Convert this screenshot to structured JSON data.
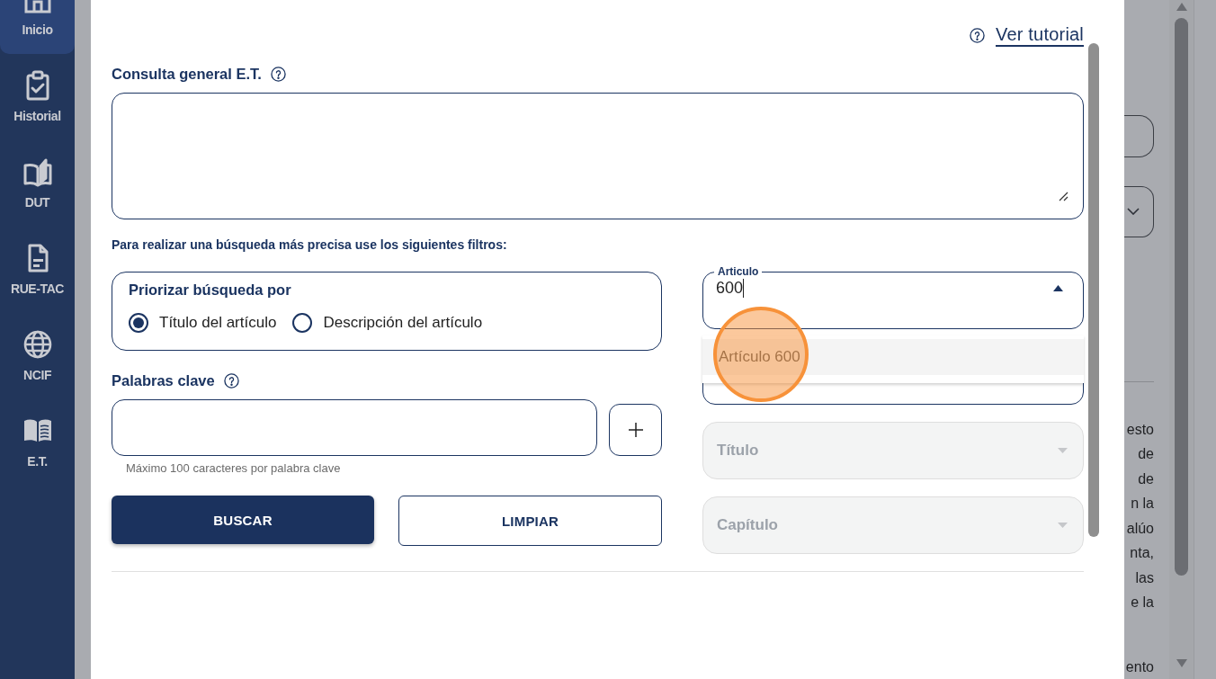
{
  "sidebar": {
    "items": [
      {
        "label": "Inicio",
        "selected": true
      },
      {
        "label": "Historial",
        "selected": false
      },
      {
        "label": "DUT",
        "selected": false
      },
      {
        "label": "RUE-TAC",
        "selected": false
      },
      {
        "label": "NCIF",
        "selected": false
      },
      {
        "label": "E.T.",
        "selected": false
      }
    ]
  },
  "dialog": {
    "tutorial_link": "Ver tutorial",
    "query": {
      "label": "Consulta general E.T."
    },
    "filters_hint": "Para realizar una búsqueda más precisa use los siguientes filtros:",
    "priority": {
      "title": "Priorizar búsqueda por",
      "options": [
        {
          "label": "Título del artículo",
          "selected": true
        },
        {
          "label": "Descripción del artículo",
          "selected": false
        }
      ]
    },
    "keywords": {
      "label": "Palabras clave",
      "hint": "Máximo 100 caracteres por palabra clave"
    },
    "buttons": [
      {
        "label": "BUSCAR",
        "kind": "primary"
      },
      {
        "label": "LIMPIAR",
        "kind": "outline"
      }
    ],
    "article": {
      "label": "Articulo",
      "value": "600",
      "expanded": true,
      "options": [
        {
          "label": "Artículo 600",
          "selected": true
        }
      ]
    },
    "selects": [
      {
        "label": "Título",
        "disabled": true
      },
      {
        "label": "Capítulo",
        "disabled": true
      }
    ]
  },
  "background_page": {
    "paragraphs": [
      [
        "esto",
        "de",
        "de",
        "n la",
        "alúo",
        "nta,",
        "las",
        "e la"
      ],
      [
        "ento"
      ]
    ]
  }
}
